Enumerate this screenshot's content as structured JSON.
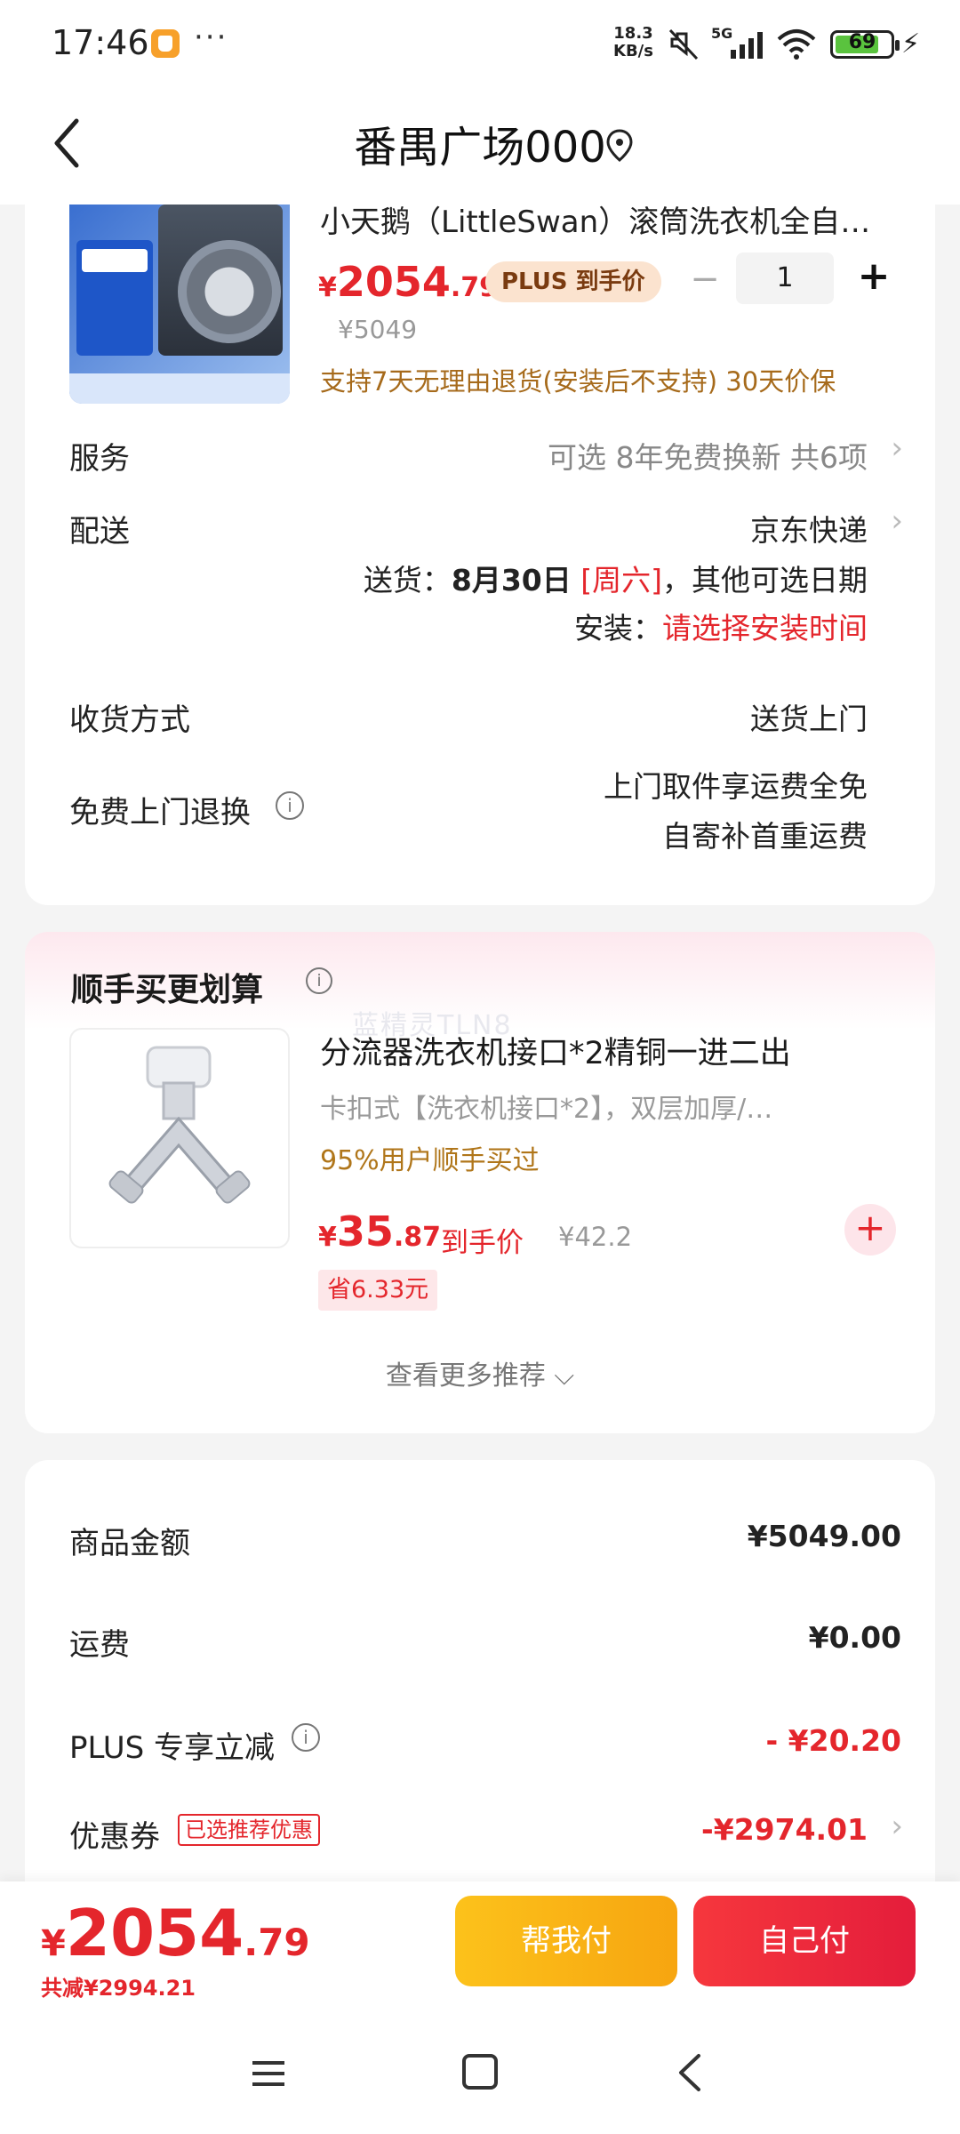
{
  "status": {
    "time": "17:46",
    "dots": "···",
    "speed_top": "18.3",
    "speed_bottom": "KB/s",
    "network": "5G",
    "battery": "69"
  },
  "header": {
    "title": "番禺广场000"
  },
  "product": {
    "title": "小天鹅（LittleSwan）滚筒洗衣机全自…",
    "price_currency": "¥",
    "price_int": "2054",
    "price_dec": ".79",
    "plus_tag": "PLUS 到手价",
    "quantity": "1",
    "original_price": "¥5049",
    "return_note": "支持7天无理由退货(安装后不支持)  30天价保"
  },
  "service": {
    "label": "服务",
    "value": "可选 8年免费换新 共6项"
  },
  "delivery": {
    "label": "配送",
    "carrier": "京东快递",
    "date_prefix": "送货：",
    "date": "8月30日",
    "weekday": "[周六]",
    "date_suffix": "，其他可选日期",
    "install_prefix": "安装：",
    "install_link": "请选择安装时间"
  },
  "receive": {
    "label": "收货方式",
    "value": "送货上门"
  },
  "free_return": {
    "label": "免费上门退换",
    "line1": "上门取件享运费全免",
    "line2": "自寄补首重运费"
  },
  "recommend": {
    "title": "顺手买更划算",
    "watermark": "蓝精灵TLN8",
    "item_name": "分流器洗衣机接口*2精铜一进二出",
    "item_desc": "卡扣式【洗衣机接口*2】，双层加厚/…",
    "bought": "95%用户顺手买过",
    "price_currency": "¥",
    "price_int": "35",
    "price_dec": ".87",
    "price_label": "到手价",
    "orig_price": "¥42.2",
    "save": "省6.33元",
    "more": "查看更多推荐 ⌵"
  },
  "summary": {
    "goods_label": "商品金额",
    "goods_value": "¥5049.00",
    "freight_label": "运费",
    "freight_value": "¥0.00",
    "plus_label": "PLUS 专享立减",
    "plus_value": "- ¥20.20",
    "coupon_label": "优惠券",
    "coupon_tag": "已选推荐优惠",
    "coupon_value": "-¥2974.01"
  },
  "footer": {
    "total_currency": "¥",
    "total_int": "2054",
    "total_dec": ".79",
    "total_save": "共减¥2994.21",
    "help_pay": "帮我付",
    "self_pay": "自己付"
  },
  "colors": {
    "accent_red": "#e4262c",
    "plus_gold": "#a66a1b",
    "help_yellow": "#fcc21b"
  }
}
